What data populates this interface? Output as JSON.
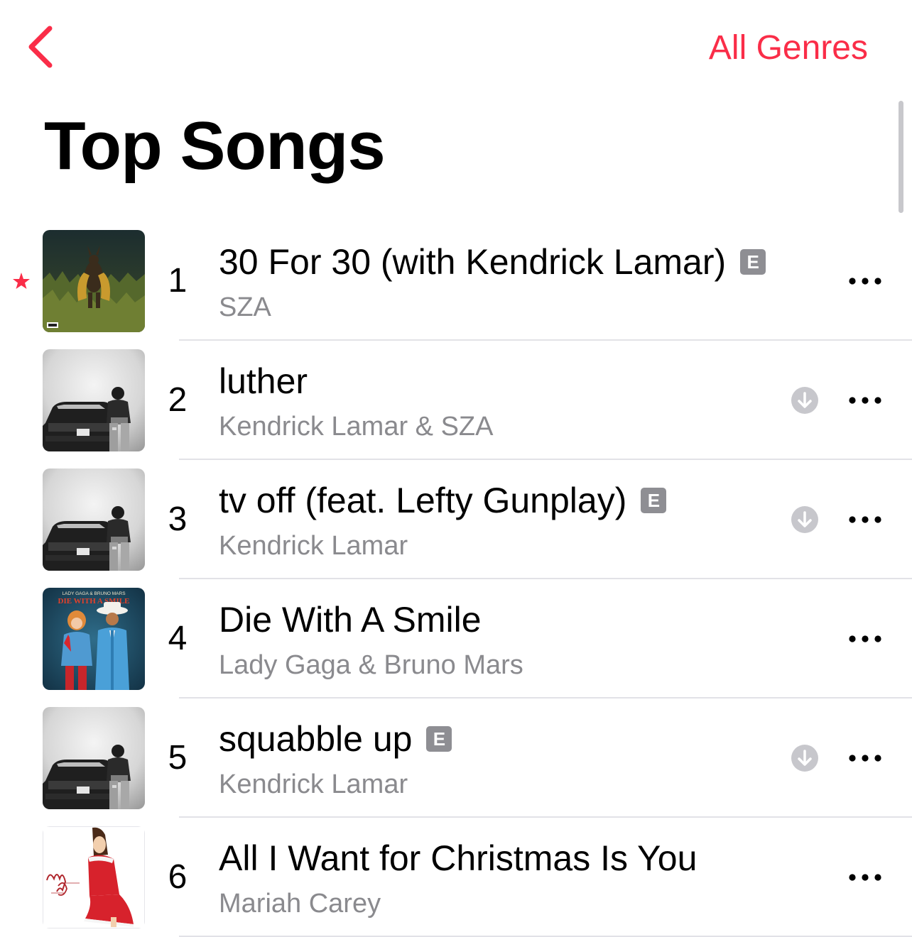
{
  "nav": {
    "back_icon": "chevron-left-icon",
    "genre_label": "All Genres"
  },
  "page": {
    "title": "Top Songs"
  },
  "colors": {
    "accent": "#fa2d48",
    "explicit_badge": "#8e8e93",
    "secondary_text": "#8a8a8e",
    "download_icon": "#c7c7cc"
  },
  "songs": [
    {
      "rank": "1",
      "title": "30 For 30 (with Kendrick Lamar)",
      "artist": "SZA",
      "explicit": true,
      "explicit_label": "E",
      "downloadable": false,
      "starred": true,
      "artwork": "sza-sos-cover"
    },
    {
      "rank": "2",
      "title": "luther",
      "artist": "Kendrick Lamar & SZA",
      "explicit": false,
      "downloadable": true,
      "starred": false,
      "artwork": "gnx-cover"
    },
    {
      "rank": "3",
      "title": "tv off (feat. Lefty Gunplay)",
      "artist": "Kendrick Lamar",
      "explicit": true,
      "explicit_label": "E",
      "downloadable": true,
      "starred": false,
      "artwork": "gnx-cover"
    },
    {
      "rank": "4",
      "title": "Die With A Smile",
      "artist": "Lady Gaga & Bruno Mars",
      "explicit": false,
      "downloadable": false,
      "starred": false,
      "artwork": "die-with-a-smile-cover",
      "artwork_text": {
        "top": "LADY GAGA & BRUNO MARS",
        "title": "DIE WITH A SMILE"
      }
    },
    {
      "rank": "5",
      "title": "squabble up",
      "artist": "Kendrick Lamar",
      "explicit": true,
      "explicit_label": "E",
      "downloadable": true,
      "starred": false,
      "artwork": "gnx-cover"
    },
    {
      "rank": "6",
      "title": "All I Want for Christmas Is You",
      "artist": "Mariah Carey",
      "explicit": false,
      "downloadable": false,
      "starred": false,
      "artwork": "merry-christmas-cover"
    }
  ]
}
